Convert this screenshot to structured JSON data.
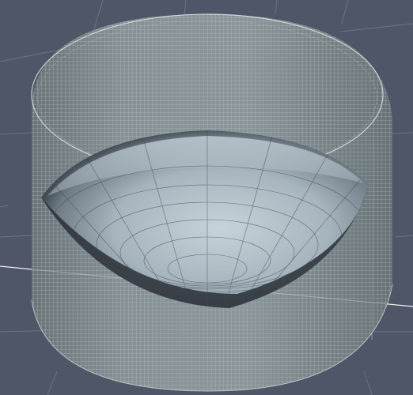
{
  "viewport": {
    "background": "#4e5667",
    "grid_color": "#6b7385",
    "axis_color": "#f2f2f2"
  },
  "model": {
    "cylinder_fill": "#8a9797",
    "cylinder_wire": "#c9d2d2",
    "bowl_light": "#c4d0d8",
    "bowl_mid": "#8e9da8",
    "bowl_dark": "#2a2f36",
    "bowl_wire": "#3f4a52"
  }
}
